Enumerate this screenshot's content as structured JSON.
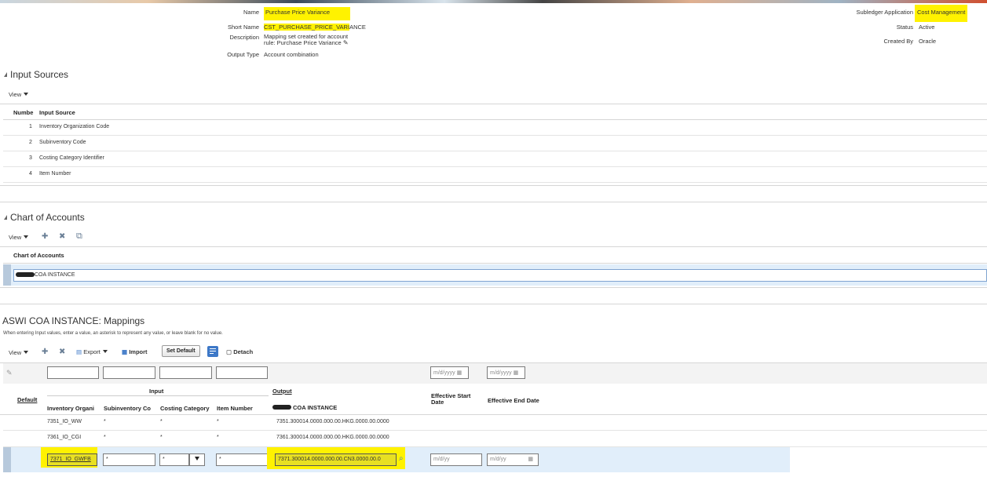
{
  "header": {
    "name_label": "Name",
    "name_value": "Purchase Price Variance",
    "short_name_label": "Short Name",
    "short_name_value_highlighted": "CST_PURCHASE_PRICE_VARI",
    "short_name_value_rest": "ANCE",
    "description_label": "Description",
    "description_line1": "Mapping set created for account",
    "description_line2": "rule: Purchase Price Variance",
    "output_type_label": "Output Type",
    "output_type_value": "Account combination",
    "subledger_label": "Subledger Application",
    "subledger_value": "Cost Management",
    "status_label": "Status",
    "status_value": "Active",
    "created_by_label": "Created By",
    "created_by_value": "Oracle"
  },
  "input_sources": {
    "title": "Input Sources",
    "view_label": "View",
    "col_number": "Numbe",
    "col_source": "Input Source",
    "rows": [
      {
        "num": "1",
        "source": "Inventory Organization Code"
      },
      {
        "num": "2",
        "source": "Subinventory Code"
      },
      {
        "num": "3",
        "source": "Costing Category Identifier"
      },
      {
        "num": "4",
        "source": "Item Number"
      }
    ]
  },
  "chart_of_accounts": {
    "title": "Chart of Accounts",
    "view_label": "View",
    "col_header": "Chart of Accounts",
    "row_value": "COA INSTANCE"
  },
  "mappings": {
    "title": "ASWI COA INSTANCE: Mappings",
    "hint": "When entering Input values, enter a value, an asterisk to represent any value, or leave blank for no value.",
    "view_label": "View",
    "export_label": "Export",
    "import_label": "Import",
    "set_default_label": "Set Default",
    "detach_label": "Detach",
    "date_placeholder_long": "m/d/yyyy",
    "date_placeholder_short": "m/d/yy",
    "col_default": "Default",
    "group_input": "Input",
    "group_output": "Output",
    "col_inv_org": "Inventory Organi",
    "col_subinv": "Subinventory Co",
    "col_costing": "Costing Category",
    "col_item": "Item Number",
    "col_coa": "COA INSTANCE",
    "col_eff_start_1": "Effective Start",
    "col_eff_start_2": "Date",
    "col_eff_end": "Effective End Date",
    "rows": [
      {
        "inv_org": "7351_IO_WW",
        "subinv": "*",
        "costing": "*",
        "item": "*",
        "coa": "7351.300014.0000.000.00.HKG.0000.00.0000"
      },
      {
        "inv_org": "7361_IO_CGI",
        "subinv": "*",
        "costing": "*",
        "item": "*",
        "coa": "7361.300014.0000.000.00.HKG.0000.00.0000"
      }
    ],
    "edit_row": {
      "inv_org": "7371_IO_GWFB",
      "subinv": "*",
      "costing": "*",
      "item": "*",
      "coa": "7371.300014.0000.000.00.CN3.0000.00.0",
      "start_date": "m/d/yy",
      "end_date": "m/d/yy"
    }
  },
  "colors": {
    "highlight": "#fff200",
    "selected_row": "#e1eefa",
    "accent": "#3d78c7"
  }
}
